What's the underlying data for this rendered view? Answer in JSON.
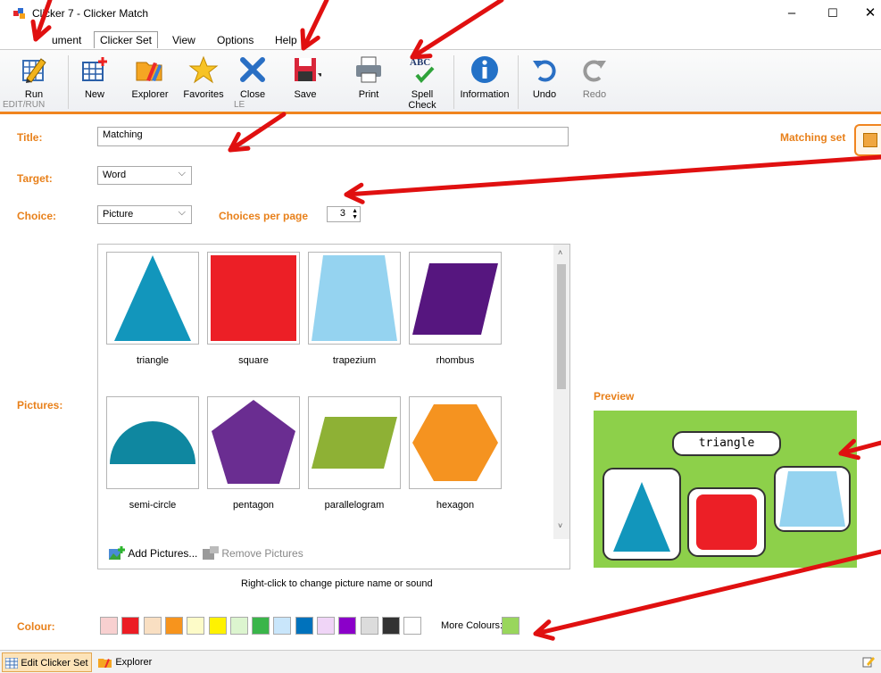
{
  "window": {
    "title": "Clicker 7 - Clicker Match",
    "minimize": "–",
    "maximize": "☐",
    "close": "✕"
  },
  "menu": {
    "items": [
      "ument",
      "Clicker Set",
      "View",
      "Options",
      "Help"
    ]
  },
  "toolbar": {
    "run": "Run",
    "edit_run_group": "EDIT/RUN",
    "new": "New",
    "explorer": "Explorer",
    "favorites": "Favorites",
    "close": "Close",
    "save": "Save",
    "print": "Print",
    "spell_check": "Spell Check",
    "spell_icon_text": "ABC",
    "information": "Information",
    "undo": "Undo",
    "redo": "Redo",
    "file_group_partial": "LE"
  },
  "form": {
    "title_label": "Title:",
    "title_value": "Matching",
    "target_label": "Target:",
    "target_value": "Word",
    "choice_label": "Choice:",
    "choice_value": "Picture",
    "choices_per_page_label": "Choices per page",
    "choices_per_page_value": "3",
    "pictures_label": "Pictures:",
    "colour_label": "Colour:",
    "more_colours_label": "More Colours:",
    "matching_set_partial": "Matching set"
  },
  "pictures": [
    {
      "name": "triangle",
      "icon": "triangle-shape",
      "color": "#1296bc"
    },
    {
      "name": "square",
      "icon": "square-shape",
      "color": "#ec1f26"
    },
    {
      "name": "trapezium",
      "icon": "trapezium-shape",
      "color": "#95d3f0"
    },
    {
      "name": "rhombus",
      "icon": "rhombus-shape",
      "color": "#56167f"
    },
    {
      "name": "semi-circle",
      "icon": "semicircle-shape",
      "color": "#0f87a0"
    },
    {
      "name": "pentagon",
      "icon": "pentagon-shape",
      "color": "#6a2d91"
    },
    {
      "name": "parallelogram",
      "icon": "parallelogram-shape",
      "color": "#8eb135"
    },
    {
      "name": "hexagon",
      "icon": "hexagon-shape",
      "color": "#f59320"
    }
  ],
  "picture_actions": {
    "add": "Add Pictures...",
    "remove": "Remove Pictures",
    "hint": "Right-click to change picture name or sound"
  },
  "preview": {
    "label": "Preview",
    "word": "triangle",
    "background": "#8dd04a"
  },
  "colours": [
    "#f8d0d0",
    "#ec1c24",
    "#f9dfc2",
    "#f7941d",
    "#fdfbc8",
    "#fff200",
    "#dcf5cf",
    "#3ab54a",
    "#c9e6fb",
    "#0072bc",
    "#f0d5f7",
    "#8b00c9",
    "#dcdcdc",
    "#333333",
    "#ffffff"
  ],
  "more_colour": "#99d65c",
  "statusbar": {
    "edit_clicker_set": "Edit Clicker Set",
    "explorer": "Explorer"
  },
  "accent_color": "#f0841e",
  "arrow_color": "#e01010"
}
